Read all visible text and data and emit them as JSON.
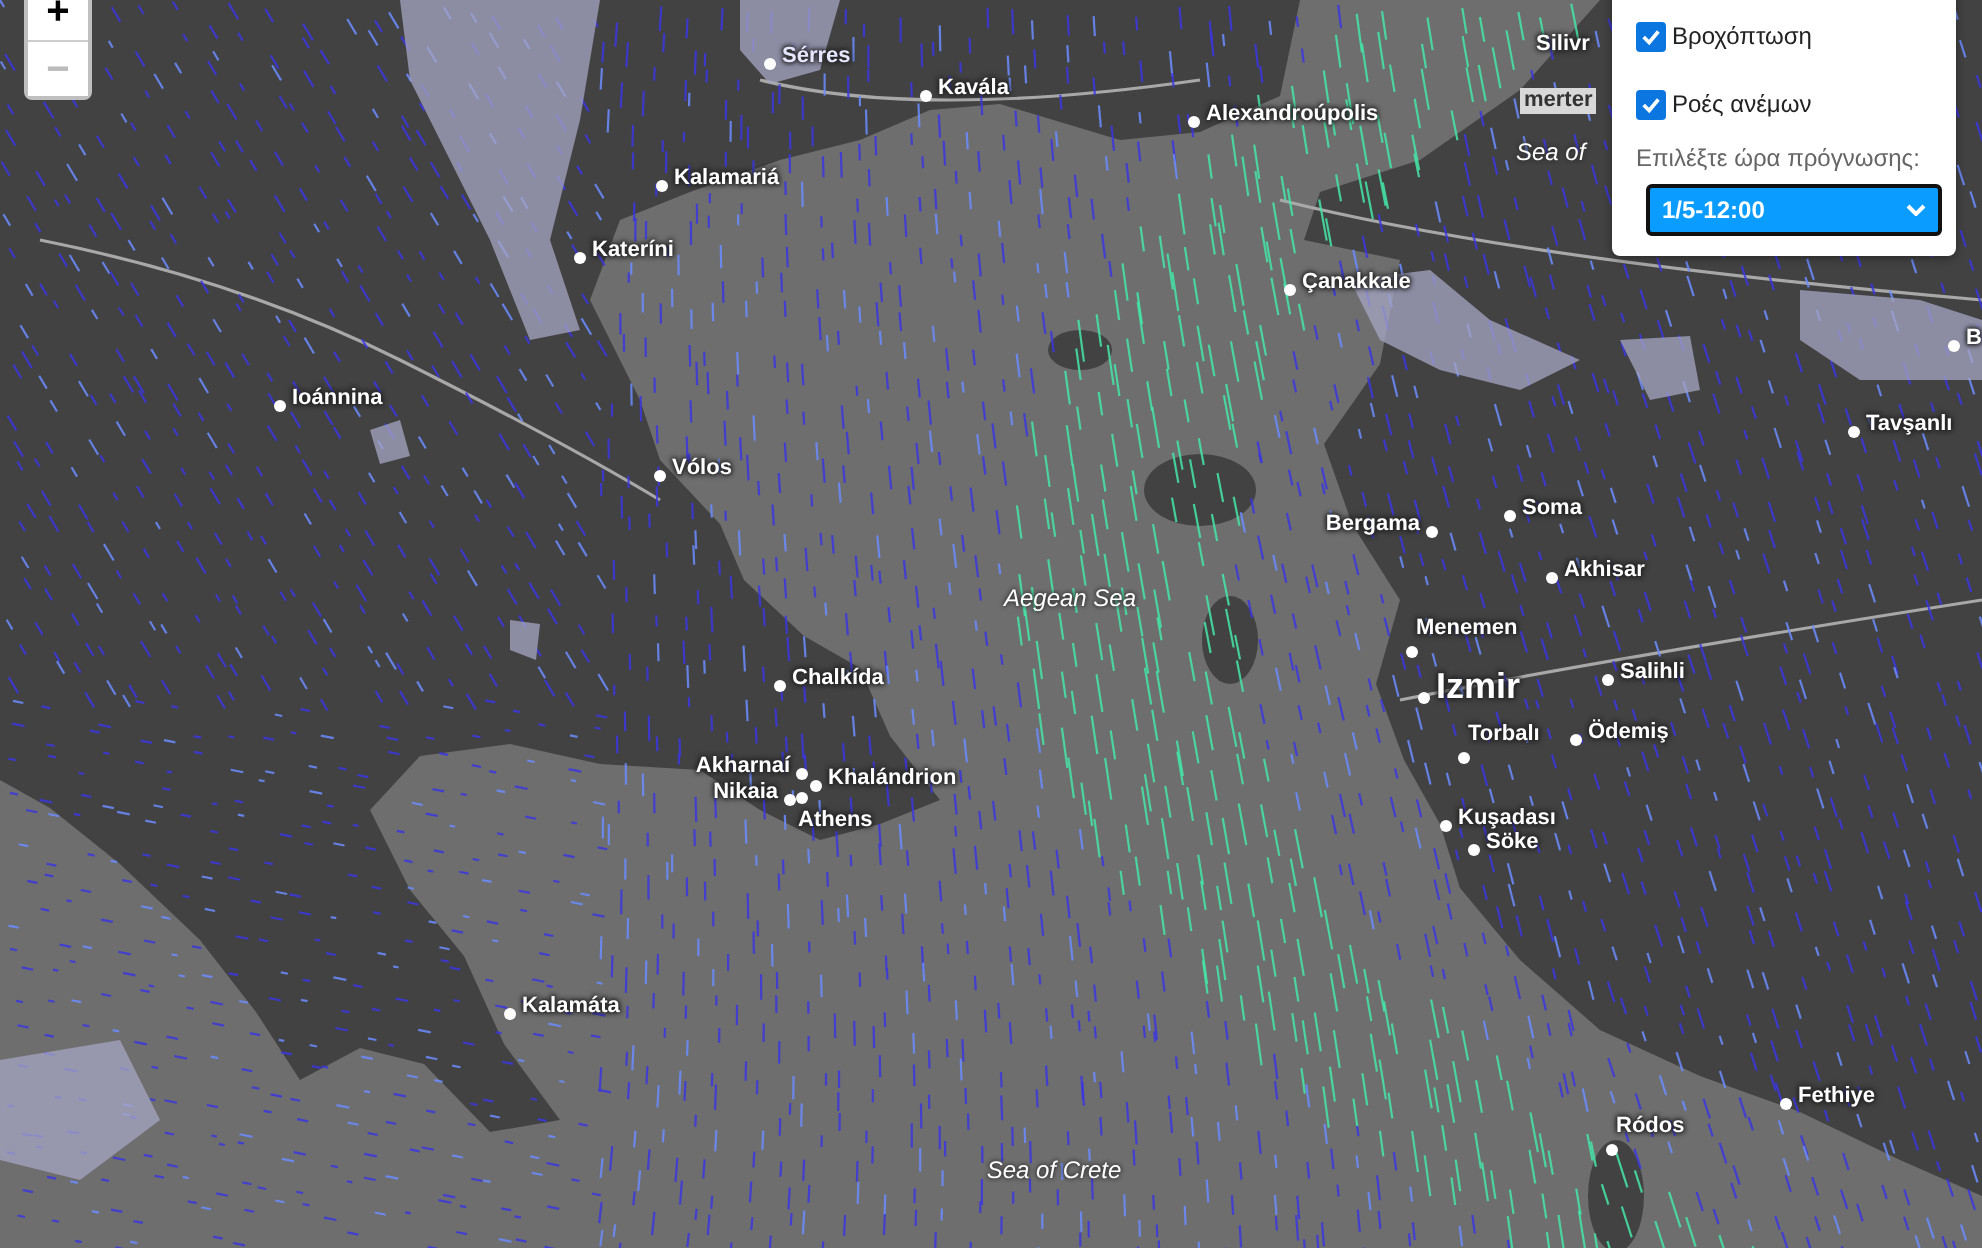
{
  "zoom_controls": [
    {
      "label": "+"
    },
    {
      "label": "−"
    }
  ],
  "places": [
    {
      "name": "Sérres",
      "kind": "rain-city"
    },
    {
      "name": "Kavála",
      "kind": "city"
    },
    {
      "name": "Alexandroúpolis",
      "kind": "city"
    },
    {
      "name": "Silivr",
      "kind": "plain"
    },
    {
      "name": "merter",
      "kind": "district"
    },
    {
      "name": "Sea of",
      "kind": "sea"
    },
    {
      "name": "Kalamariá",
      "kind": "city"
    },
    {
      "name": "Kateríni",
      "kind": "city"
    },
    {
      "name": "Çanakkale",
      "kind": "city"
    },
    {
      "name": "B",
      "kind": "city"
    },
    {
      "name": "Ioánnina",
      "kind": "city"
    },
    {
      "name": "Tavşanlı",
      "kind": "city"
    },
    {
      "name": "Vólos",
      "kind": "city"
    },
    {
      "name": "Bergama",
      "kind": "city"
    },
    {
      "name": "Soma",
      "kind": "city"
    },
    {
      "name": "Aegean Sea",
      "kind": "sea"
    },
    {
      "name": "Akhisar",
      "kind": "city"
    },
    {
      "name": "Menemen",
      "kind": "city"
    },
    {
      "name": "Chalkída",
      "kind": "city"
    },
    {
      "name": "Izmir",
      "kind": "major"
    },
    {
      "name": "Salihli",
      "kind": "city"
    },
    {
      "name": "Torbalı",
      "kind": "city"
    },
    {
      "name": "Ödemiş",
      "kind": "city"
    },
    {
      "name": "Akharnaí",
      "kind": "city"
    },
    {
      "name": "Khalándrion",
      "kind": "city"
    },
    {
      "name": "Nikaia",
      "kind": "city"
    },
    {
      "name": "Athens",
      "kind": "city"
    },
    {
      "name": "Kuşadası",
      "kind": "city"
    },
    {
      "name": "Söke",
      "kind": "city"
    },
    {
      "name": "Kalamáta",
      "kind": "city"
    },
    {
      "name": "Fethiye",
      "kind": "city"
    },
    {
      "name": "Ródos",
      "kind": "city"
    },
    {
      "name": "Sea of Crete",
      "kind": "sea"
    }
  ],
  "layer_panel": {
    "layers": [
      {
        "label": "Βροχόπτωση",
        "checked": true
      },
      {
        "label": "Ροές ανέμων",
        "checked": true
      }
    ],
    "forecast_label": "Επιλέξτε ώρα πρόγνωσης:",
    "forecast_select": {
      "value": "1/5-12:00"
    }
  }
}
